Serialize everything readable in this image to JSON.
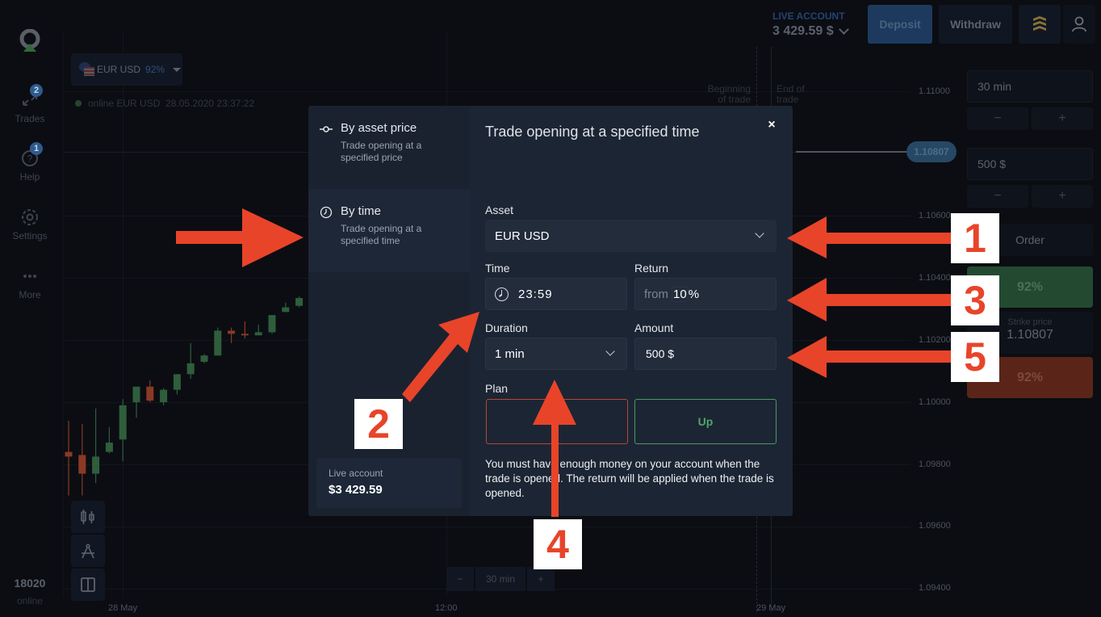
{
  "sidebar": {
    "items": [
      {
        "label": "Trades",
        "icon": "trades-arrows-icon",
        "badge": "2"
      },
      {
        "label": "Help",
        "icon": "help-icon",
        "badge": "1"
      },
      {
        "label": "Settings",
        "icon": "gear-icon"
      },
      {
        "label": "More",
        "icon": "more-dots-icon"
      }
    ],
    "online_count": "18020",
    "online_label": "online"
  },
  "header": {
    "account_type": "LIVE ACCOUNT",
    "balance": "3 429.59 $",
    "deposit_label": "Deposit",
    "withdraw_label": "Withdraw",
    "colors": {
      "deposit": "#1d3a5e",
      "status_icon": "#8a7236"
    }
  },
  "chart": {
    "asset": "EUR USD",
    "asset_payout": "92%",
    "status_line": "online EUR USD  28.05.2020 23:37:22",
    "beginning_of_trade": [
      "Beginning",
      "of trade"
    ],
    "end_of_trade": [
      "End of",
      "trade"
    ],
    "current_price": "1.10807",
    "price_ticks": [
      "1.11000",
      "1.10600",
      "1.10400",
      "1.10200",
      "1.10000",
      "1.09800",
      "1.09600",
      "1.09400"
    ],
    "time_ticks": [
      "28 May",
      "12:00",
      "29 May"
    ],
    "zoom_minus": "−",
    "zoom_value": "30 min",
    "zoom_plus": "+",
    "colors": {
      "up_candle": "#2f5e3c",
      "down_candle": "#8a3a24"
    },
    "candles": [
      {
        "o": 1.0984,
        "c": 1.09825,
        "h": 1.0994,
        "l": 1.097
      },
      {
        "o": 1.0983,
        "c": 1.0977,
        "h": 1.0993,
        "l": 1.097
      },
      {
        "o": 1.0977,
        "c": 1.09825,
        "h": 1.0998,
        "l": 1.0974
      },
      {
        "o": 1.0984,
        "c": 1.0987,
        "h": 1.0992,
        "l": 1.09835
      },
      {
        "o": 1.0988,
        "c": 1.0999,
        "h": 1.1001,
        "l": 1.0981
      },
      {
        "o": 1.1,
        "c": 1.1005,
        "h": 1.1005,
        "l": 1.0995
      },
      {
        "o": 1.1005,
        "c": 1.10005,
        "h": 1.1007,
        "l": 1.1
      },
      {
        "o": 1.1,
        "c": 1.1004,
        "h": 1.10045,
        "l": 1.0999
      },
      {
        "o": 1.1004,
        "c": 1.1009,
        "h": 1.1009,
        "l": 1.10025
      },
      {
        "o": 1.1009,
        "c": 1.10125,
        "h": 1.1019,
        "l": 1.10075
      },
      {
        "o": 1.1013,
        "c": 1.1015,
        "h": 1.10155,
        "l": 1.10125
      },
      {
        "o": 1.1015,
        "c": 1.1023,
        "h": 1.1024,
        "l": 1.1015
      },
      {
        "o": 1.1023,
        "c": 1.1022,
        "h": 1.1024,
        "l": 1.1019
      },
      {
        "o": 1.1022,
        "c": 1.10215,
        "h": 1.1026,
        "l": 1.10205
      },
      {
        "o": 1.10215,
        "c": 1.10225,
        "h": 1.1025,
        "l": 1.10215
      },
      {
        "o": 1.10225,
        "c": 1.1028,
        "h": 1.1028,
        "l": 1.1022
      },
      {
        "o": 1.1029,
        "c": 1.10305,
        "h": 1.1032,
        "l": 1.1029
      },
      {
        "o": 1.1031,
        "c": 1.10335,
        "h": 1.1034,
        "l": 1.10305
      }
    ]
  },
  "right_panel": {
    "duration": "30 min",
    "amount": "500 $",
    "minus": "−",
    "plus": "+",
    "order_label": "Order",
    "up_payout": "92%",
    "strike_label": "Strike price",
    "strike_value": "1.10807",
    "down_payout": "92%"
  },
  "modal": {
    "modes": [
      {
        "title": "By asset price",
        "subtitle": "Trade opening at a specified price",
        "icon": "price-slider-icon",
        "active": false
      },
      {
        "title": "By time",
        "subtitle": "Trade opening at a specified time",
        "icon": "clock-icon",
        "active": true
      }
    ],
    "account_label": "Live account",
    "account_balance": "$3 429.59",
    "title": "Trade opening at a specified time",
    "close_icon": "×",
    "asset_label": "Asset",
    "asset_value": "EUR USD",
    "time_label": "Time",
    "time_value": "23:59",
    "return_label": "Return",
    "return_prefix": "from",
    "return_value": "10",
    "return_suffix": "%",
    "duration_label": "Duration",
    "duration_value": "1 min",
    "amount_label": "Amount",
    "amount_value": "500 $",
    "plan_label": "Plan",
    "plan_up_label": "Up",
    "plan_down_label": "",
    "note": "You must have enough money on your account when the trade is opened. The return will be applied when the trade is opened.",
    "colors": {
      "plan_down_border": "#b4483a",
      "plan_up_border": "#4a9a64"
    }
  },
  "annotations": {
    "numbers": [
      "1",
      "2",
      "3",
      "4",
      "5"
    ],
    "color": "#e8442a"
  }
}
